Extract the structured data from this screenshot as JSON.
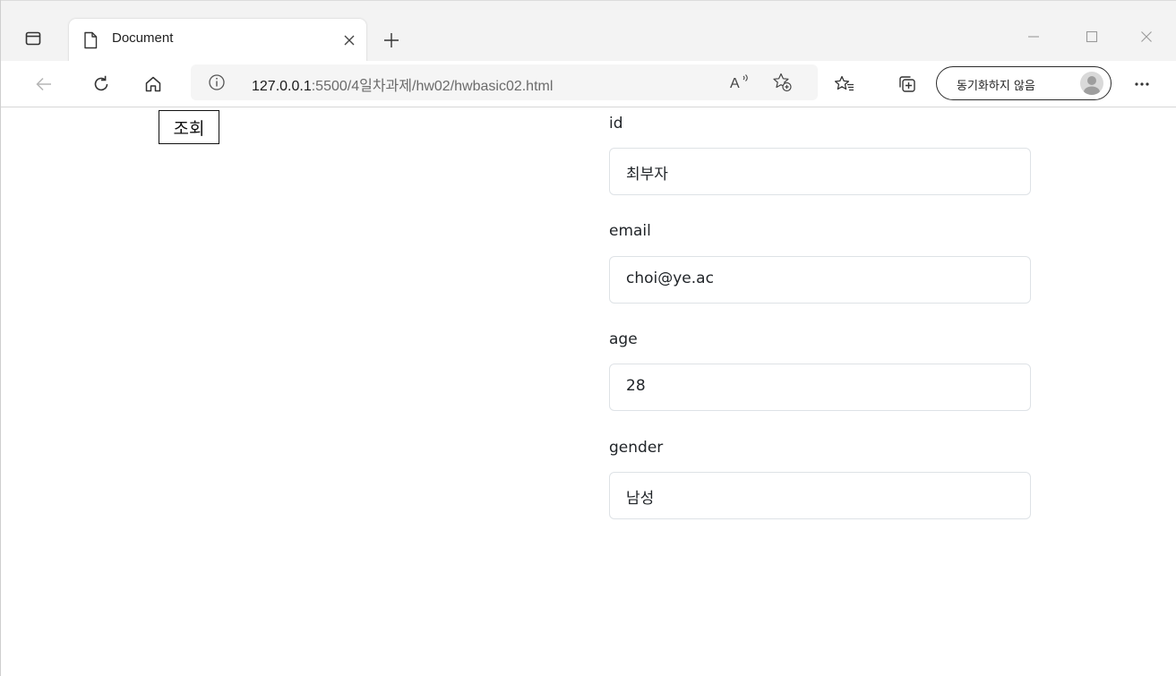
{
  "browser": {
    "tab": {
      "title": "Document"
    },
    "address": {
      "host": "127.0.0.1",
      "path": ":5500/4일차과제/hw02/hwbasic02.html"
    },
    "profile": {
      "label": "동기화하지 않음"
    },
    "read_aloud_label": "A"
  },
  "page": {
    "lookup_button": "조회",
    "fields": [
      {
        "label": "id",
        "value": "최부자"
      },
      {
        "label": "email",
        "value": "choi@ye.ac"
      },
      {
        "label": "age",
        "value": "28"
      },
      {
        "label": "gender",
        "value": "남성"
      }
    ]
  },
  "icons": {
    "tab_actions": "tab-actions-icon",
    "doc": "document-icon",
    "close": "close-icon",
    "new_tab": "plus-icon",
    "back": "back-arrow-icon",
    "refresh": "refresh-icon",
    "home": "home-icon",
    "info": "info-icon",
    "read_aloud": "read-aloud-icon",
    "add_favorite": "add-favorite-icon",
    "favorites": "favorites-icon",
    "collections": "collections-icon",
    "avatar": "avatar-icon",
    "more": "more-icon"
  },
  "colors": {
    "tabstrip_bg": "#f3f3f3",
    "input_border": "#dee2e6",
    "text": "#212529"
  }
}
